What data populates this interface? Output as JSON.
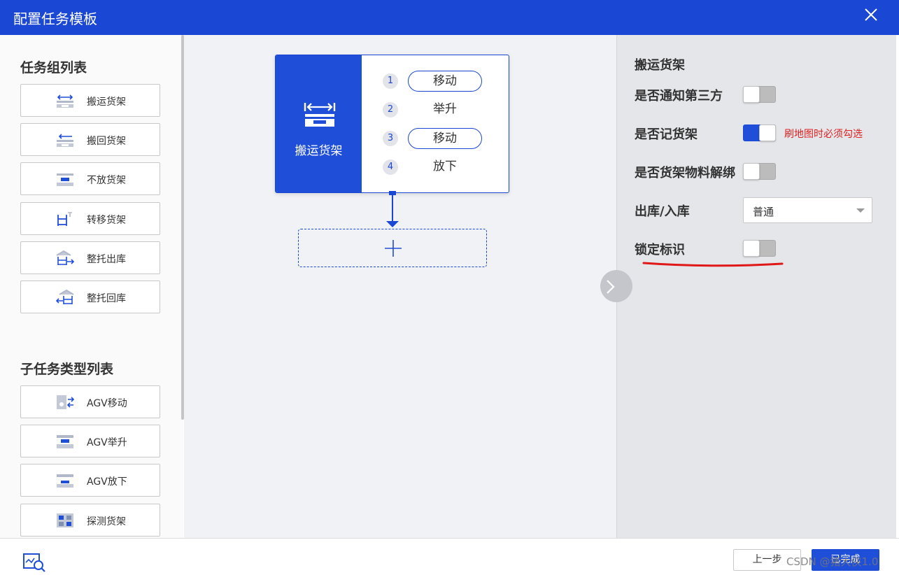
{
  "dialog": {
    "title": "配置任务模板"
  },
  "left": {
    "group_title": "任务组列表",
    "groups": [
      {
        "label": "搬运货架",
        "icon": "shelf-move-icon"
      },
      {
        "label": "搬回货架",
        "icon": "shelf-return-icon"
      },
      {
        "label": "不放货架",
        "icon": "shelf-keep-icon"
      },
      {
        "label": "转移货架",
        "icon": "shelf-transfer-icon"
      },
      {
        "label": "整托出库",
        "icon": "pallet-out-icon"
      },
      {
        "label": "整托回库",
        "icon": "pallet-in-icon"
      }
    ],
    "subtype_title": "子任务类型列表",
    "subtypes": [
      {
        "label": "AGV移动",
        "icon": "agv-move-icon"
      },
      {
        "label": "AGV举升",
        "icon": "agv-lift-icon"
      },
      {
        "label": "AGV放下",
        "icon": "agv-drop-icon"
      },
      {
        "label": "探测货架",
        "icon": "shelf-detect-icon"
      }
    ]
  },
  "canvas": {
    "task": {
      "name": "搬运货架",
      "steps": [
        {
          "num": "1",
          "label": "移动"
        },
        {
          "num": "2",
          "label": "举升"
        },
        {
          "num": "3",
          "label": "移动"
        },
        {
          "num": "4",
          "label": "放下"
        }
      ]
    }
  },
  "props": {
    "title": "搬运货架",
    "notify_third_party": {
      "label": "是否通知第三方",
      "on": false
    },
    "record_shelf": {
      "label": "是否记货架",
      "on": true,
      "hint": "刷地图时必须勾选"
    },
    "unbind_material": {
      "label": "是否货架物料解绑",
      "on": false
    },
    "direction": {
      "label": "出库/入库",
      "value": "普通"
    },
    "lock_flag": {
      "label": "锁定标识",
      "on": false
    },
    "accent_color": "#1f4ed8",
    "hint_color": "#e02020"
  },
  "footer": {
    "prev": "上一步",
    "done": "已完成",
    "watermark": "CSDN @猪大侠1.0"
  }
}
